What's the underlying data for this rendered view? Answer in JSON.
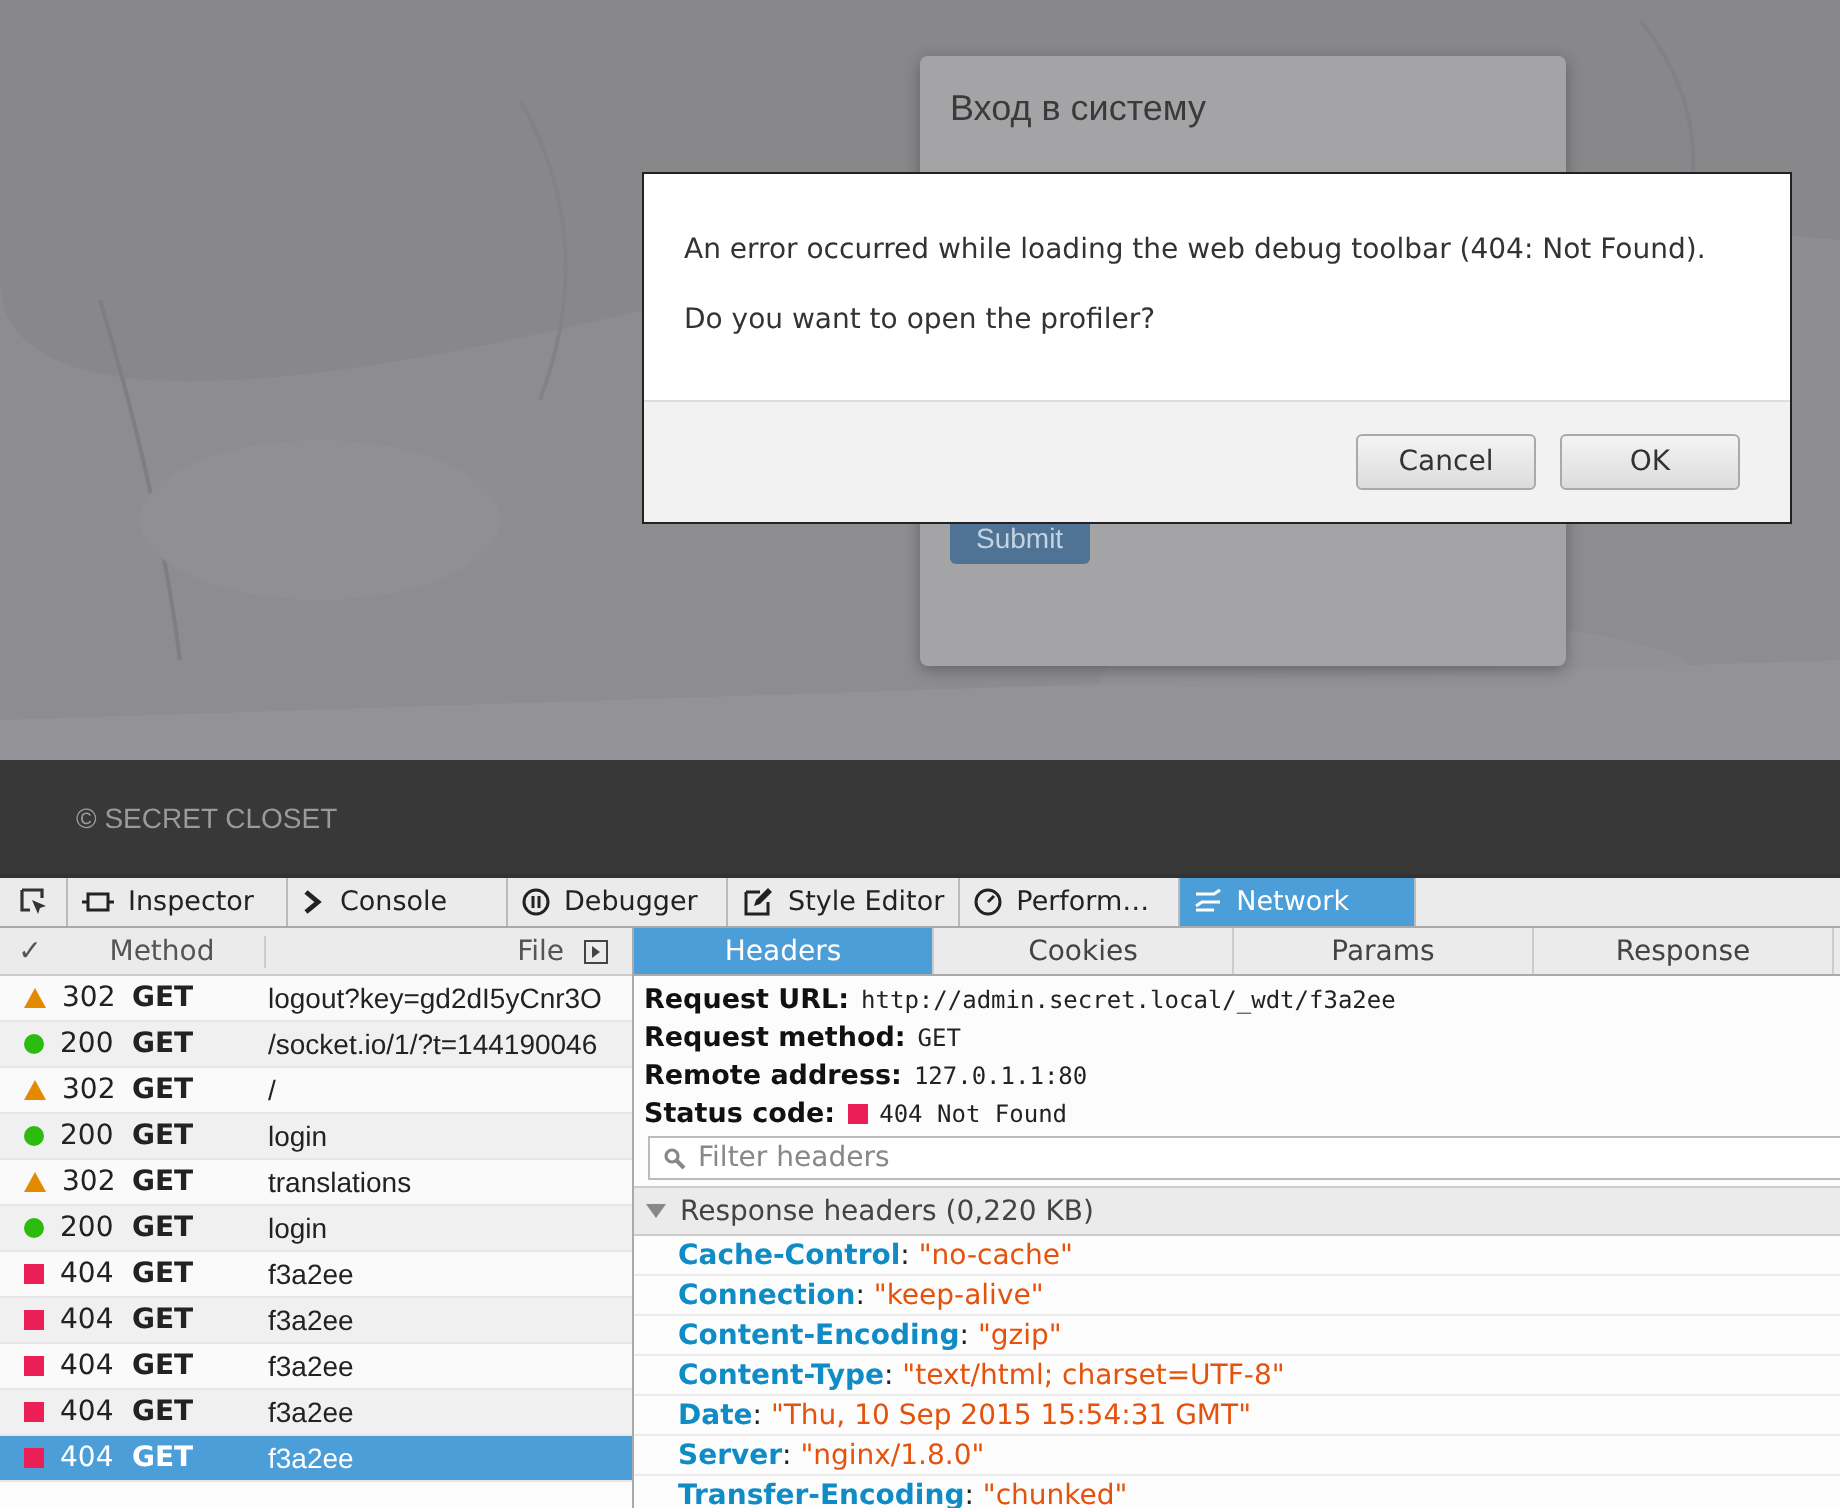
{
  "page": {
    "login_title": "Вход в систему",
    "submit": "Submit",
    "footer": "© SECRET CLOSET"
  },
  "dialog": {
    "message": "An error occurred while loading the web debug toolbar (404: Not Found).",
    "question": "Do you want to open the profiler?",
    "buttons": [
      "Cancel",
      "OK"
    ]
  },
  "devtools": {
    "tabs": [
      {
        "label": "Inspector",
        "kind": "inspector",
        "selected": false
      },
      {
        "label": "Console",
        "kind": "console",
        "selected": false
      },
      {
        "label": "Debugger",
        "kind": "debugger",
        "selected": false
      },
      {
        "label": "Style Editor",
        "kind": "style",
        "selected": false
      },
      {
        "label": "Perform…",
        "kind": "performance",
        "selected": false
      },
      {
        "label": "Network",
        "kind": "network",
        "selected": true
      }
    ],
    "columns": {
      "check": "✓",
      "method": "Method",
      "file": "File"
    },
    "requests": [
      {
        "kind": "redirect",
        "status": "302",
        "method": "GET",
        "file": "logout?key=gd2dI5yCnr3O",
        "selected": false
      },
      {
        "kind": "ok",
        "status": "200",
        "method": "GET",
        "file": "/socket.io/1/?t=144190046",
        "selected": false
      },
      {
        "kind": "redirect",
        "status": "302",
        "method": "GET",
        "file": "/",
        "selected": false
      },
      {
        "kind": "ok",
        "status": "200",
        "method": "GET",
        "file": "login",
        "selected": false
      },
      {
        "kind": "redirect",
        "status": "302",
        "method": "GET",
        "file": "translations",
        "selected": false
      },
      {
        "kind": "ok",
        "status": "200",
        "method": "GET",
        "file": "login",
        "selected": false
      },
      {
        "kind": "error",
        "status": "404",
        "method": "GET",
        "file": "f3a2ee",
        "selected": false
      },
      {
        "kind": "error",
        "status": "404",
        "method": "GET",
        "file": "f3a2ee",
        "selected": false
      },
      {
        "kind": "error",
        "status": "404",
        "method": "GET",
        "file": "f3a2ee",
        "selected": false
      },
      {
        "kind": "error",
        "status": "404",
        "method": "GET",
        "file": "f3a2ee",
        "selected": false
      },
      {
        "kind": "error",
        "status": "404",
        "method": "GET",
        "file": "f3a2ee",
        "selected": true
      }
    ],
    "detail_tabs": [
      {
        "label": "Headers",
        "selected": true
      },
      {
        "label": "Cookies",
        "selected": false
      },
      {
        "label": "Params",
        "selected": false
      },
      {
        "label": "Response",
        "selected": false
      }
    ],
    "summary": [
      {
        "label": "Request URL:",
        "value": "http://admin.secret.local/_wdt/f3a2ee"
      },
      {
        "label": "Request method:",
        "value": "GET"
      },
      {
        "label": "Remote address:",
        "value": "127.0.1.1:80"
      },
      {
        "label": "Status code:",
        "value": "404 Not Found",
        "kind": "error"
      }
    ],
    "filter": {
      "placeholder": "Filter headers"
    },
    "response_headers": {
      "title": "Response headers (0,220 KB)",
      "expanded": true,
      "items": [
        {
          "name": "Cache-Control",
          "separator": ":",
          "value": "\"no-cache\""
        },
        {
          "name": "Connection",
          "separator": ":",
          "value": "\"keep-alive\""
        },
        {
          "name": "Content-Encoding",
          "separator": ":",
          "value": "\"gzip\""
        },
        {
          "name": "Content-Type",
          "separator": ":",
          "value": "\"text/html; charset=UTF-8\""
        },
        {
          "name": "Date",
          "separator": ":",
          "value": "\"Thu, 10 Sep 2015 15:54:31 GMT\""
        },
        {
          "name": "Server",
          "separator": ":",
          "value": "\"nginx/1.8.0\""
        },
        {
          "name": "Transfer-Encoding",
          "separator": ":",
          "value": "\"chunked\""
        }
      ]
    }
  }
}
